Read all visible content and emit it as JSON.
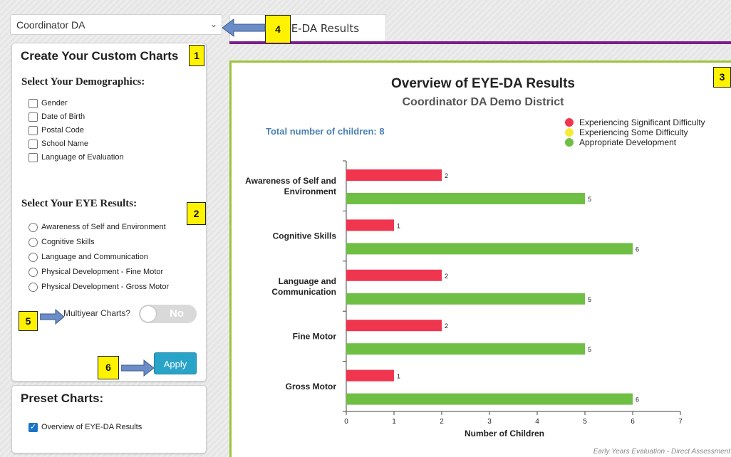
{
  "dropdown": {
    "selected": "Coordinator DA"
  },
  "tab": {
    "label": "f EYE-DA Results"
  },
  "custom": {
    "title": "Create Your Custom Charts",
    "demographics_title": "Select Your Demographics:",
    "demographics": [
      {
        "label": "Gender",
        "checked": false
      },
      {
        "label": "Date of Birth",
        "checked": false
      },
      {
        "label": "Postal Code",
        "checked": false
      },
      {
        "label": "School Name",
        "checked": false
      },
      {
        "label": "Language of Evaluation",
        "checked": false
      }
    ],
    "results_title": "Select Your EYE Results:",
    "results": [
      {
        "label": "Awareness of Self and Environment"
      },
      {
        "label": "Cognitive Skills"
      },
      {
        "label": "Language and Communication"
      },
      {
        "label": "Physical Development - Fine Motor"
      },
      {
        "label": "Physical Development - Gross Motor"
      }
    ],
    "multiyear_label": "Multiyear Charts?",
    "toggle_text": "No",
    "apply_label": "Apply"
  },
  "preset": {
    "title": "Preset Charts:",
    "items": [
      {
        "label": "Overview of EYE-DA Results",
        "checked": true
      }
    ]
  },
  "callouts": [
    "1",
    "2",
    "3",
    "4",
    "5",
    "6"
  ],
  "colors": {
    "accent_purple": "#7b1e8c",
    "chart_border": "#9dc33b",
    "apply_blue": "#2aa3c9"
  },
  "chart": {
    "title": "Overview of EYE-DA Results",
    "subtitle": "Coordinator DA Demo District",
    "total_label": "Total number of children: 8",
    "footer": "Early Years Evaluation - Direct Assessment"
  },
  "chart_data": {
    "type": "bar",
    "orientation": "horizontal",
    "categories": [
      "Awareness of Self and\nEnvironment",
      "Cognitive Skills",
      "Language and\nCommunication",
      "Fine Motor",
      "Gross Motor"
    ],
    "series": [
      {
        "name": "Experiencing Significant Difficulty",
        "color": "#f0364f",
        "values": [
          2,
          1,
          2,
          2,
          1
        ]
      },
      {
        "name": "Experiencing Some Difficulty",
        "color": "#f5ec3a",
        "values": [
          0,
          0,
          0,
          0,
          0
        ]
      },
      {
        "name": "Appropriate Development",
        "color": "#70bf45",
        "values": [
          5,
          6,
          5,
          5,
          6
        ]
      }
    ],
    "xlabel": "Number of Children",
    "xticks": [
      "0",
      "1",
      "2",
      "3",
      "4",
      "5",
      "6",
      "7"
    ],
    "xlim": [
      0,
      7
    ],
    "legend": "top-right"
  }
}
